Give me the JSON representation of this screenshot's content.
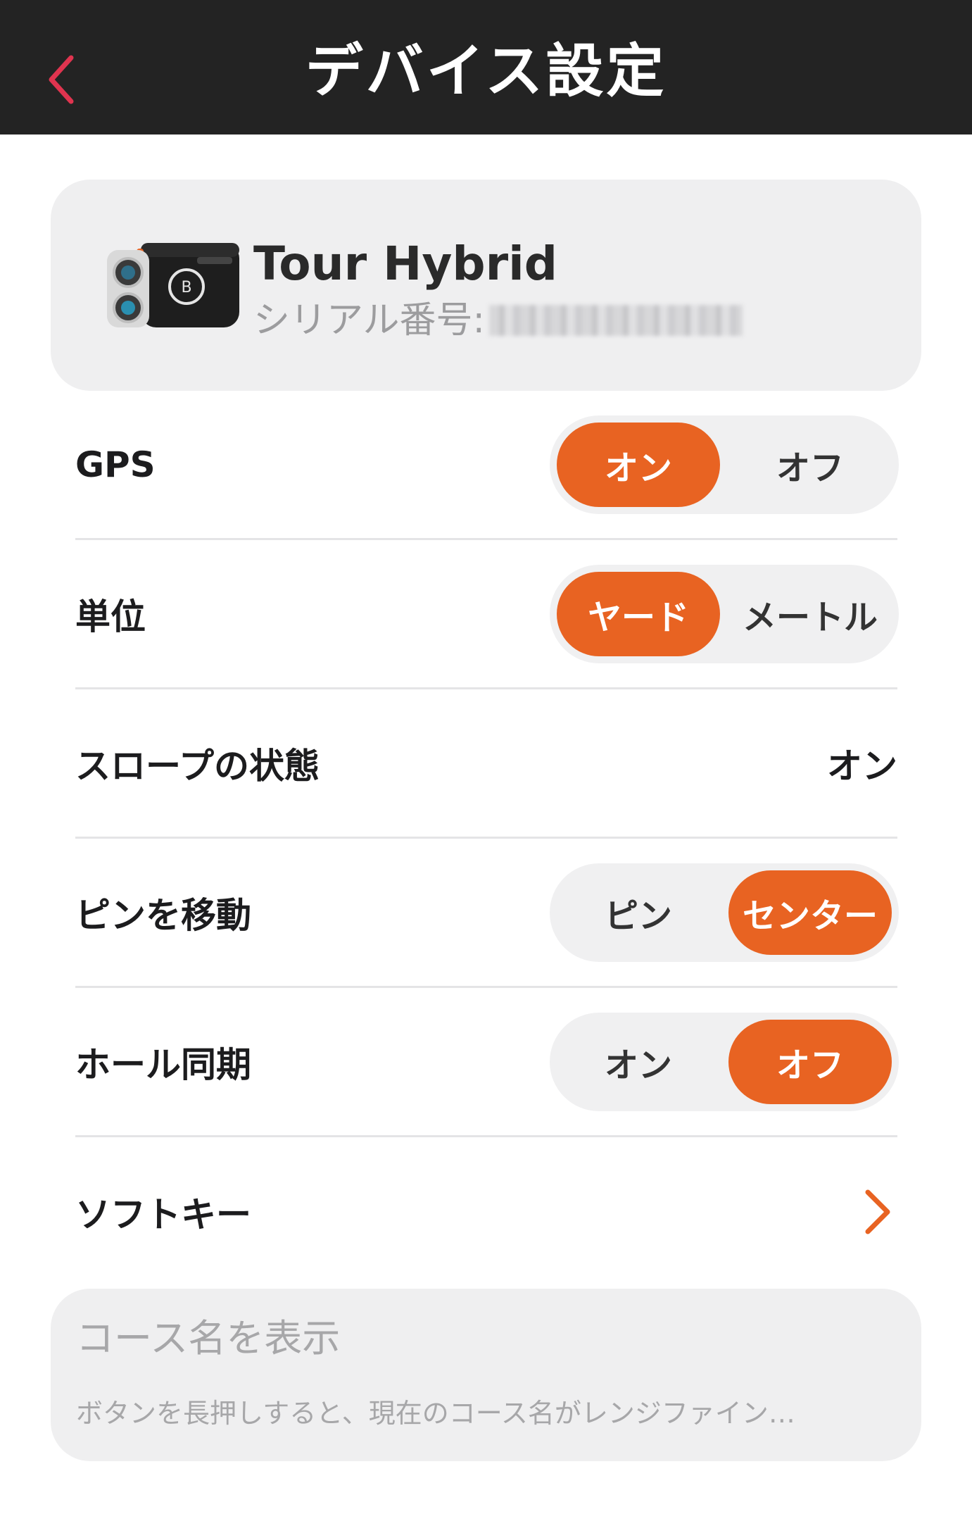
{
  "header": {
    "title": "デバイス設定",
    "back_icon": "chevron-left-icon",
    "back_color": "#e0344f"
  },
  "device": {
    "name": "Tour Hybrid",
    "serial_label": "シリアル番号:",
    "image_icon": "rangefinder-device-image"
  },
  "settings": {
    "gps": {
      "label": "GPS",
      "options": [
        "オン",
        "オフ"
      ],
      "selected": "オン"
    },
    "unit": {
      "label": "単位",
      "options": [
        "ヤード",
        "メートル"
      ],
      "selected": "ヤード"
    },
    "slope": {
      "label": "スロープの状態",
      "value": "オン"
    },
    "pin": {
      "label": "ピンを移動",
      "options": [
        "ピン",
        "センター"
      ],
      "selected": "センター"
    },
    "hole_sync": {
      "label": "ホール同期",
      "options": [
        "オン",
        "オフ"
      ],
      "selected": "オフ"
    },
    "softkey": {
      "label": "ソフトキー",
      "icon": "chevron-right-icon"
    }
  },
  "course_name": {
    "title": "コース名を表示",
    "description": "ボタンを長押しすると、現在のコース名がレンジファイン…"
  },
  "colors": {
    "accent": "#e86322",
    "header_bg": "#232323",
    "card_bg": "#efeff0"
  }
}
